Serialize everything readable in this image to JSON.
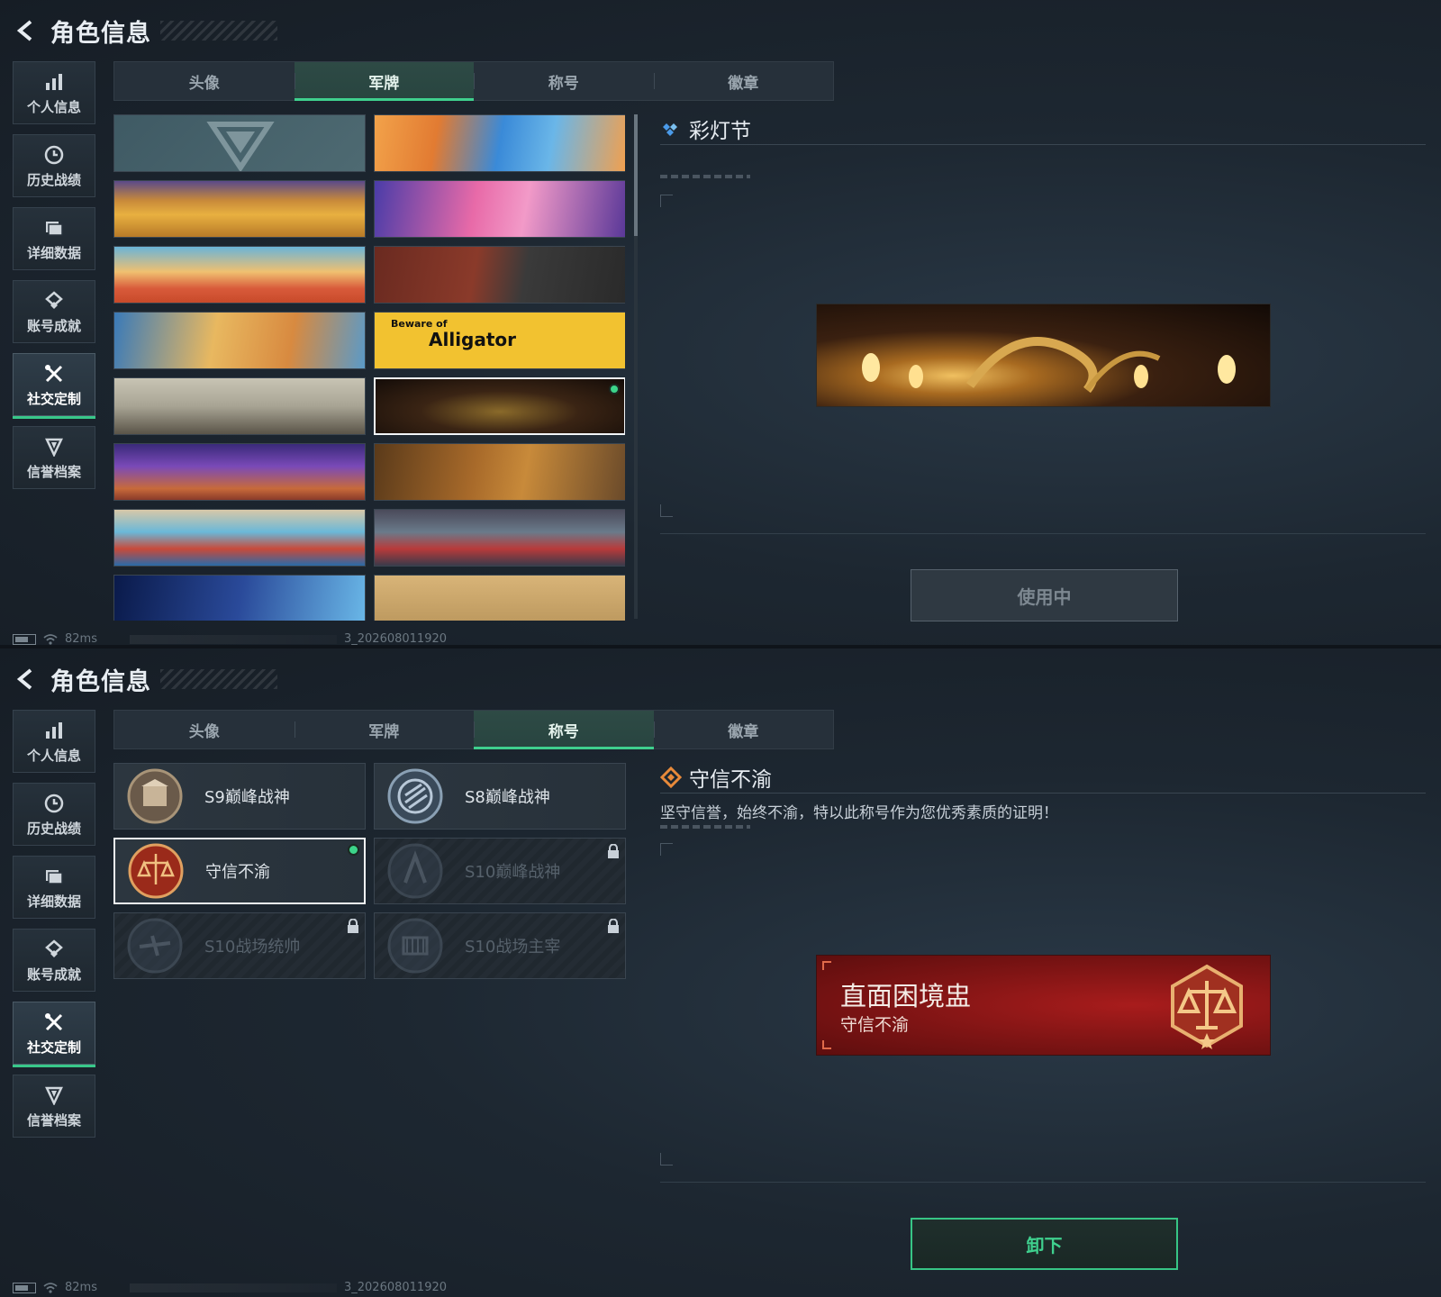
{
  "screen1": {
    "header_title": "角色信息",
    "sidebar": [
      {
        "label": "个人信息",
        "icon": "bar-chart-icon"
      },
      {
        "label": "历史战绩",
        "icon": "clock-icon"
      },
      {
        "label": "详细数据",
        "icon": "folder-icon"
      },
      {
        "label": "账号成就",
        "icon": "achievement-icon"
      },
      {
        "label": "社交定制",
        "icon": "tools-icon",
        "active": true
      },
      {
        "label": "信誉档案",
        "icon": "shield-icon"
      }
    ],
    "tabs": [
      "头像",
      "军牌",
      "称号",
      "徽章"
    ],
    "active_tab": "军牌",
    "detail": {
      "title": "彩灯节",
      "button": "使用中"
    },
    "banner_text": {
      "line1": "Beware of",
      "line2": "Alligator"
    },
    "footer": {
      "ping": "82ms",
      "build": "3_202608011920"
    }
  },
  "screen2": {
    "header_title": "角色信息",
    "sidebar": [
      {
        "label": "个人信息",
        "icon": "bar-chart-icon"
      },
      {
        "label": "历史战绩",
        "icon": "clock-icon"
      },
      {
        "label": "详细数据",
        "icon": "folder-icon"
      },
      {
        "label": "账号成就",
        "icon": "achievement-icon"
      },
      {
        "label": "社交定制",
        "icon": "tools-icon",
        "active": true
      },
      {
        "label": "信誉档案",
        "icon": "shield-icon"
      }
    ],
    "tabs": [
      "头像",
      "军牌",
      "称号",
      "徽章"
    ],
    "active_tab": "称号",
    "titles": [
      {
        "name": "S9巅峰战神",
        "locked": false
      },
      {
        "name": "S8巅峰战神",
        "locked": false
      },
      {
        "name": "守信不渝",
        "locked": false,
        "selected": true
      },
      {
        "name": "S10巅峰战神",
        "locked": true
      },
      {
        "name": "S10战场统帅",
        "locked": true
      },
      {
        "name": "S10战场主宰",
        "locked": true
      }
    ],
    "detail": {
      "title": "守信不渝",
      "description": "坚守信誉，始终不渝，特以此称号作为您优秀素质的证明！",
      "preview_big": "直面困境盅",
      "preview_small": "守信不渝",
      "button": "卸下"
    },
    "footer": {
      "ping": "82ms",
      "build": "3_202608011920"
    }
  },
  "colors": {
    "accent": "#3fd08e",
    "title_card_red": "#8e1616"
  }
}
